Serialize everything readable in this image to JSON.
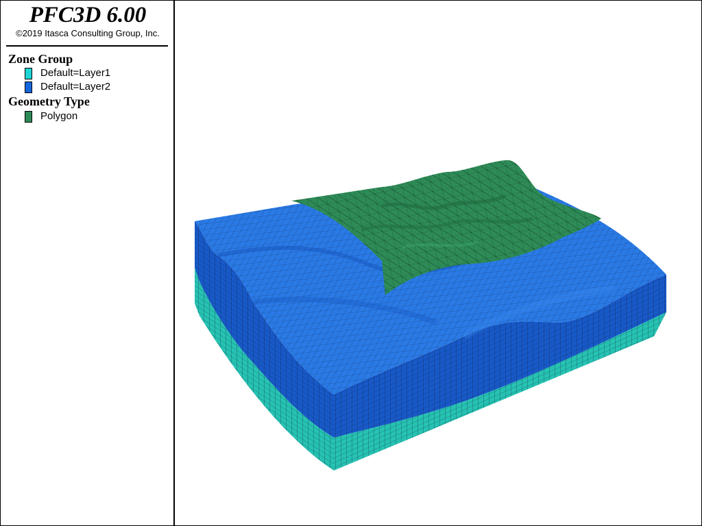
{
  "app": {
    "title": "PFC3D 6.00",
    "copyright": "©2019 Itasca Consulting Group, Inc."
  },
  "legend": {
    "sections": [
      {
        "title": "Zone Group",
        "items": [
          {
            "label": "Default=Layer1",
            "color": "#1fd4d4"
          },
          {
            "label": "Default=Layer2",
            "color": "#1565dc"
          }
        ]
      },
      {
        "title": "Geometry Type",
        "items": [
          {
            "label": "Polygon",
            "color": "#2e8b57"
          }
        ]
      }
    ]
  },
  "colors": {
    "layer1_side": "#26c2b2",
    "layer2_top": "#2a7ae6",
    "layer2_side": "#1859c8",
    "polygon": "#2e8b57",
    "mesh_line": "#0a1e3a"
  }
}
